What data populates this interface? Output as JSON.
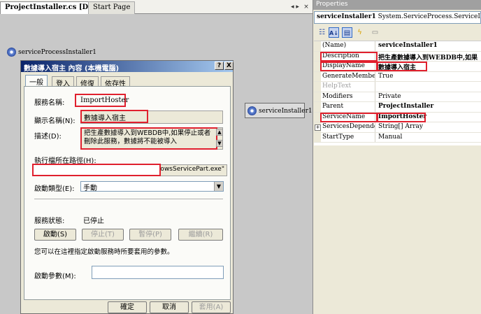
{
  "designer": {
    "active_tab": "ProjectInstaller.cs [Design]*",
    "start_tab": "Start Page",
    "close_glyph": "×",
    "scroll_glyph": "◂ ▸",
    "components": {
      "process_installer": "serviceProcessInstaller1",
      "service_installer": "serviceInstaller1"
    }
  },
  "dialog": {
    "title": "數據導入宿主 內容 (本機電腦)",
    "help_button": "?",
    "close_button": "X",
    "tabs": [
      "一般",
      "登入",
      "修復",
      "依存性"
    ],
    "service_name_label": "服務名稱:",
    "service_name_value": "ImportHoster",
    "display_name_label": "顯示名稱(N):",
    "display_name_value": "數據導入宿主",
    "description_label": "描述(D):",
    "description_value": "把生產數據導入到WEBDB中,如果停止或者刪除此服務，數據將不能被導入",
    "exec_path_label": "執行檔所在路徑(H):",
    "exec_path_value": "windowsServicePart.exe\"",
    "startup_type_label": "啟動類型(E):",
    "startup_type_value": "手動",
    "service_status_label": "服務狀態:",
    "service_status_value": "已停止",
    "buttons": {
      "start": "啟動(S)",
      "stop": "停止(T)",
      "pause": "暫停(P)",
      "resume": "繼續(R)"
    },
    "start_params_hint": "您可以在這裡指定啟動服務時所要套用的參數。",
    "start_params_label": "啟動參數(M):",
    "start_params_value": "",
    "footer": {
      "ok": "確定",
      "cancel": "取消",
      "apply": "套用(A)"
    }
  },
  "properties": {
    "panel_title": "Properties",
    "object_name": "serviceInstaller1",
    "object_type": "System.ServiceProcess.ServiceInstaller",
    "toolbar_icons": [
      "categorized-icon",
      "alphabetical-icon",
      "properties-icon",
      "events-icon",
      "property-pages-icon"
    ],
    "rows": [
      {
        "name": "(Name)",
        "value": "serviceInstaller1",
        "bold": true
      },
      {
        "name": "Description",
        "value": "把生產數據導入到WEBDB中,如果",
        "bold": true
      },
      {
        "name": "DisplayName",
        "value": "數據導入宿主",
        "bold": true
      },
      {
        "name": "GenerateMember",
        "value": "True",
        "bold": false
      },
      {
        "name": "HelpText",
        "value": "",
        "bold": false
      },
      {
        "name": "Modifiers",
        "value": "Private",
        "bold": false
      },
      {
        "name": "Parent",
        "value": "ProjectInstaller",
        "bold": true
      },
      {
        "name": "ServiceName",
        "value": "ImportHoster",
        "bold": true
      },
      {
        "name": "ServicesDependedOn",
        "value": "String[] Array",
        "bold": false
      },
      {
        "name": "StartType",
        "value": "Manual",
        "bold": false
      }
    ]
  },
  "colors": {
    "highlight": "#e0202e",
    "title_bar": "#0a246a",
    "designer_bg": "#c8c8c8"
  }
}
